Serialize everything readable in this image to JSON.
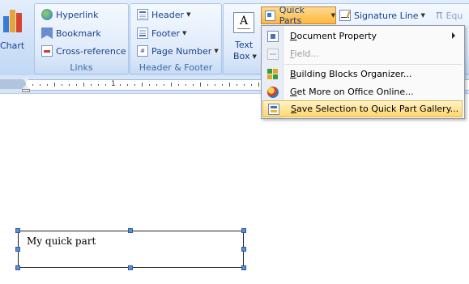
{
  "insert": {
    "chart_label": "Chart",
    "links": {
      "label": "Links",
      "hyperlink": "Hyperlink",
      "bookmark": "Bookmark",
      "cross_reference": "Cross-reference"
    },
    "header_footer": {
      "label": "Header & Footer",
      "header": "Header",
      "footer": "Footer",
      "page_number": "Page Number"
    },
    "text": {
      "text_box_line1": "Text",
      "text_box_line2": "Box",
      "quick_parts": "Quick Parts",
      "signature_line": "Signature Line",
      "equation": "Equ"
    }
  },
  "quick_parts_menu": {
    "items": [
      {
        "label": "Document Property",
        "accel": "D",
        "rest": "ocument Property",
        "icon": "document-property-icon"
      },
      {
        "label": "Field...",
        "accel": "F",
        "rest": "ield...",
        "icon": "field-icon"
      },
      {
        "label": "Building Blocks Organizer...",
        "accel": "B",
        "rest": "uilding Blocks Organizer...",
        "icon": "building-blocks-icon"
      },
      {
        "label": "Get More on Office Online...",
        "accel": "G",
        "rest": "et More on Office Online...",
        "icon": "office-online-icon"
      },
      {
        "label": "Save Selection to Quick Part Gallery...",
        "accel": "S",
        "rest": "ave Selection to Quick Part Gallery...",
        "icon": "save-quick-part-icon"
      }
    ]
  },
  "ruler": {
    "number": "1"
  },
  "document": {
    "textbox_text": "My quick part"
  },
  "colors": {
    "ribbon_text": "#15428b",
    "highlight": "#ffd66d"
  }
}
